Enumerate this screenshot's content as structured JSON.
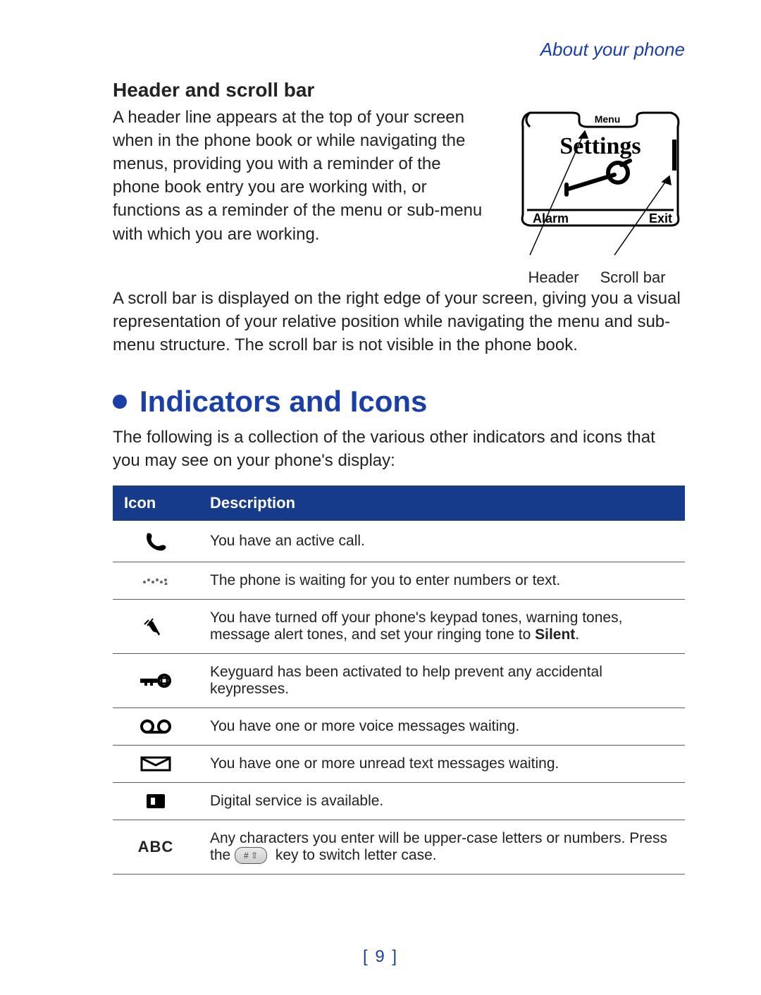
{
  "header_right": "About your phone",
  "h_header_scroll": "Header and scroll bar",
  "para1": "A header line appears at the top of your screen when in the phone book or while navigating the menus, providing you with a reminder of the phone book entry you are working with, or functions as a reminder of the menu or sub-menu with which you are working.",
  "fig": {
    "menu": "Menu",
    "settings": "Settings",
    "alarm": "Alarm",
    "exit": "Exit",
    "caption_header": "Header",
    "caption_scroll": "Scroll bar"
  },
  "para2": "A scroll bar is displayed on the right edge of your screen, giving you a visual representation of your relative position while navigating the menu and sub-menu structure. The scroll bar is not visible in the phone book.",
  "section_title": "Indicators and Icons",
  "para3": "The following is a collection of the various other indicators and icons that you may see on your phone's display:",
  "table": {
    "th_icon": "Icon",
    "th_desc": "Description",
    "rows": [
      {
        "icon": "active-call-icon",
        "desc": "You have an active call."
      },
      {
        "icon": "waiting-input-icon",
        "desc": "The phone is waiting for you to enter numbers or text."
      },
      {
        "icon": "silent-icon",
        "desc_pre": "You have turned off your phone's keypad tones, warning tones, message alert tones, and set your ringing tone to ",
        "desc_bold": "Silent",
        "desc_post": "."
      },
      {
        "icon": "keyguard-icon",
        "desc": "Keyguard has been activated to help prevent any accidental keypresses."
      },
      {
        "icon": "voicemail-icon",
        "desc": "You have one or more voice messages waiting."
      },
      {
        "icon": "text-message-icon",
        "desc": "You have one or more unread text messages waiting."
      },
      {
        "icon": "digital-service-icon",
        "desc": "Digital service is available."
      },
      {
        "icon": "uppercase-icon",
        "desc_pre": "Any characters you enter will be upper-case letters or numbers. Press the ",
        "key_label": "# ⇧",
        "desc_post": " key to switch letter case."
      }
    ]
  },
  "page_number": "[ 9 ]"
}
